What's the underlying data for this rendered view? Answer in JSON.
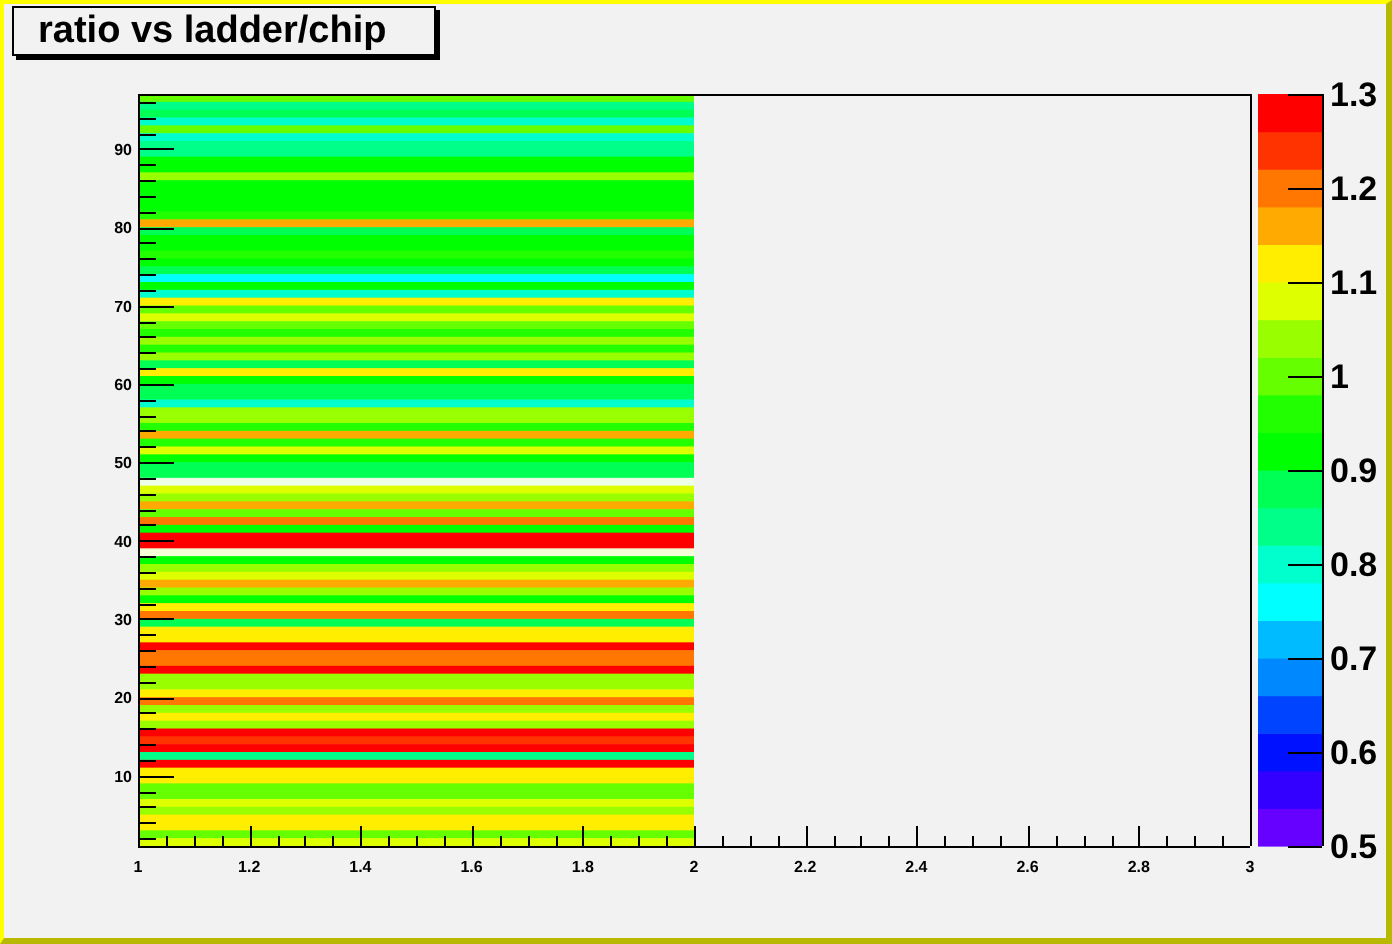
{
  "title": "ratio vs ladder/chip",
  "x_axis": {
    "labels": [
      "1",
      "1.2",
      "1.4",
      "1.6",
      "1.8",
      "2",
      "2.2",
      "2.4",
      "2.6",
      "2.8",
      "3"
    ]
  },
  "y_axis": {
    "labels": [
      "90",
      "80",
      "70",
      "60",
      "50",
      "40",
      "30",
      "20",
      "10"
    ]
  },
  "color_scale": {
    "labels": [
      "1.3",
      "1.2",
      "1.1",
      "1",
      "0.9",
      "0.8",
      "0.7",
      "0.6",
      "0.5"
    ],
    "bins": [
      {
        "color": "#6600ff"
      },
      {
        "color": "#3300ff"
      },
      {
        "color": "#0011ff"
      },
      {
        "color": "#0044ff"
      },
      {
        "color": "#0088ff"
      },
      {
        "color": "#00bbff"
      },
      {
        "color": "#00ffff"
      },
      {
        "color": "#00ffcc"
      },
      {
        "color": "#00ff88"
      },
      {
        "color": "#00ff55"
      },
      {
        "color": "#00ff00"
      },
      {
        "color": "#22ff00"
      },
      {
        "color": "#66ff00"
      },
      {
        "color": "#99ff00"
      },
      {
        "color": "#ddff00"
      },
      {
        "color": "#ffee00"
      },
      {
        "color": "#ffaa00"
      },
      {
        "color": "#ff7700"
      },
      {
        "color": "#ff3300"
      },
      {
        "color": "#ff0000"
      }
    ]
  },
  "heatmap": {
    "rows": [
      {
        "color": "#66ff00"
      },
      {
        "color": "#00ff88"
      },
      {
        "color": "#00ff55"
      },
      {
        "color": "#00ffcc"
      },
      {
        "color": "#66ff00"
      },
      {
        "color": "#00ffcc"
      },
      {
        "color": "#00ff88"
      },
      {
        "color": "#00ff88"
      },
      {
        "color": "#00ff00"
      },
      {
        "color": "#00ff00"
      },
      {
        "color": "#99ff00"
      },
      {
        "color": "#00ff00"
      },
      {
        "color": "#00ff00"
      },
      {
        "color": "#00ff00"
      },
      {
        "color": "#00ff00"
      },
      {
        "color": "#22ff00"
      },
      {
        "color": "#ffaa00"
      },
      {
        "color": "#00ff55"
      },
      {
        "color": "#00ff00"
      },
      {
        "color": "#00ff00"
      },
      {
        "color": "#22ff00"
      },
      {
        "color": "#00ff00"
      },
      {
        "color": "#00ff55"
      },
      {
        "color": "#00ffff"
      },
      {
        "color": "#00ff00"
      },
      {
        "color": "#00ffcc"
      },
      {
        "color": "#ffee00"
      },
      {
        "color": "#66ff00"
      },
      {
        "color": "#ddff00"
      },
      {
        "color": "#66ff00"
      },
      {
        "color": "#22ff00"
      },
      {
        "color": "#99ff00"
      },
      {
        "color": "#22ff00"
      },
      {
        "color": "#99ff00"
      },
      {
        "color": "#00ff55"
      },
      {
        "color": "#ffee00"
      },
      {
        "color": "#00ff00"
      },
      {
        "color": "#00ff55"
      },
      {
        "color": "#00ff55"
      },
      {
        "color": "#00ffcc"
      },
      {
        "color": "#99ff00"
      },
      {
        "color": "#99ff00"
      },
      {
        "color": "#22ff00"
      },
      {
        "color": "#ffaa00"
      },
      {
        "color": "#22ff00"
      },
      {
        "color": "#ddff00"
      },
      {
        "color": "#00ff00"
      },
      {
        "color": "#00ff55"
      },
      {
        "color": "#00ff55"
      },
      {
        "color": "#eeffe8"
      },
      {
        "color": "#ddff00"
      },
      {
        "color": "#99ff00"
      },
      {
        "color": "#ffaa00"
      },
      {
        "color": "#66ff00"
      },
      {
        "color": "#ff7700"
      },
      {
        "color": "#00ff00"
      },
      {
        "color": "#ff0000"
      },
      {
        "color": "#ff0000"
      },
      {
        "color": "#f4ffd8"
      },
      {
        "color": "#00ff00"
      },
      {
        "color": "#99ff00"
      },
      {
        "color": "#ddff00"
      },
      {
        "color": "#ffaa00"
      },
      {
        "color": "#99ff00"
      },
      {
        "color": "#00ff00"
      },
      {
        "color": "#ffee00"
      },
      {
        "color": "#ff7700"
      },
      {
        "color": "#00ff55"
      },
      {
        "color": "#ffee00"
      },
      {
        "color": "#ffee00"
      },
      {
        "color": "#ff0000"
      },
      {
        "color": "#ff7700"
      },
      {
        "color": "#ff7700"
      },
      {
        "color": "#ff0000"
      },
      {
        "color": "#99ff00"
      },
      {
        "color": "#99ff00"
      },
      {
        "color": "#ffee00"
      },
      {
        "color": "#ff7700"
      },
      {
        "color": "#99ff00"
      },
      {
        "color": "#ffee00"
      },
      {
        "color": "#99ff00"
      },
      {
        "color": "#ff0000"
      },
      {
        "color": "#ff3300"
      },
      {
        "color": "#ff0000"
      },
      {
        "color": "#00ff88"
      },
      {
        "color": "#ff0000"
      },
      {
        "color": "#ffee00"
      },
      {
        "color": "#ffee00"
      },
      {
        "color": "#66ff00"
      },
      {
        "color": "#66ff00"
      },
      {
        "color": "#ddff00"
      },
      {
        "color": "#99ff00"
      },
      {
        "color": "#ffee00"
      },
      {
        "color": "#ffee00"
      },
      {
        "color": "#66ff00"
      },
      {
        "color": "#ddff00"
      }
    ]
  }
}
